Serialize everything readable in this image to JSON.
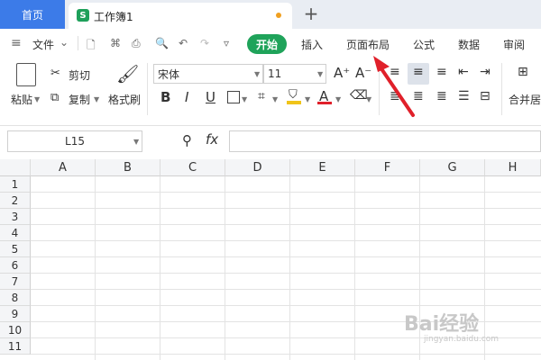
{
  "titlebar": {
    "home_tab": "首页",
    "doc_icon": "S",
    "doc_tab": "工作簿1",
    "new_tab": "+"
  },
  "menu": {
    "file": "文件",
    "tabs": [
      "开始",
      "插入",
      "页面布局",
      "公式",
      "数据",
      "审阅"
    ]
  },
  "ribbon": {
    "paste": "粘贴",
    "cut": "剪切",
    "copy": "复制",
    "format_painter": "格式刷",
    "font_name": "宋体",
    "font_size": "11",
    "bold": "B",
    "italic": "I",
    "underline": "U",
    "font_grow": "A⁺",
    "font_shrink": "A⁻",
    "merge": "合并居",
    "font_color": "A"
  },
  "formula_bar": {
    "name_box": "L15",
    "fx": "fx",
    "formula": ""
  },
  "sheet": {
    "columns": [
      "A",
      "B",
      "C",
      "D",
      "E",
      "F",
      "G",
      "H"
    ],
    "rows": [
      "1",
      "2",
      "3",
      "4",
      "5",
      "6",
      "7",
      "8",
      "9",
      "10",
      "11"
    ]
  },
  "watermark": {
    "text": "Bai经验",
    "sub": "jingyan.baidu.com"
  },
  "colors": {
    "home_tab": "#3c7be8",
    "start_tab": "#1fa35a",
    "arrow": "#e0202a"
  },
  "icons": [
    "menu-icon",
    "chevron-down-icon",
    "save-icon",
    "print-icon",
    "undo-icon",
    "redo-icon",
    "scissors-icon",
    "copy-icon",
    "brush-icon",
    "zoom-icon",
    "eraser-icon",
    "border-icon",
    "fill-color-icon"
  ]
}
